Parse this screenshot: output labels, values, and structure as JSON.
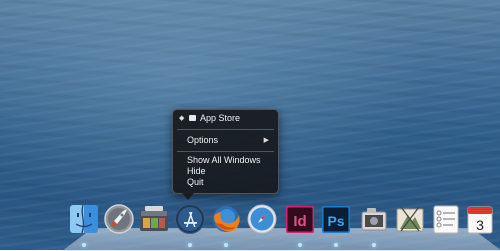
{
  "menu": {
    "app_name": "App Store",
    "options": "Options",
    "show_all_windows": "Show All Windows",
    "hide": "Hide",
    "quit": "Quit"
  },
  "dock": {
    "items": [
      "finder-icon",
      "launchpad-icon",
      "photo-browser-icon",
      "app-store-icon",
      "firefox-icon",
      "safari-icon",
      "indesign-icon",
      "photoshop-icon",
      "preview-icon",
      "image-capture-icon",
      "reminders-icon",
      "calendar-icon"
    ],
    "indesign_label": "Id",
    "photoshop_label": "Ps",
    "calendar_day": "3"
  },
  "colors": {
    "indesign": "#d9236c",
    "photoshop": "#1b7fd0",
    "menu_bg": "#1b1d21"
  }
}
